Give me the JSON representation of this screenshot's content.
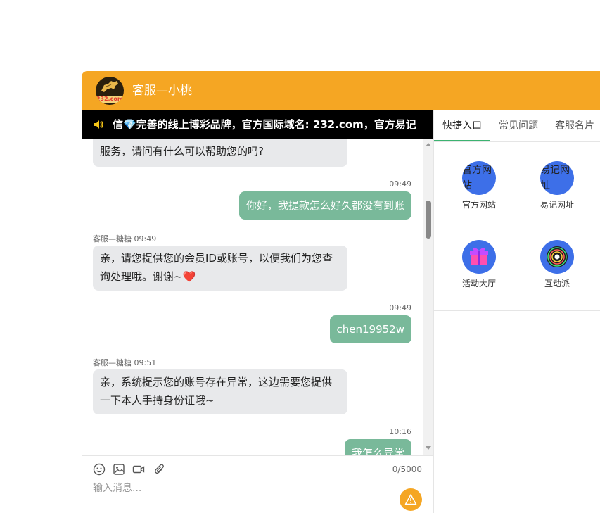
{
  "header": {
    "title": "客服—小桃",
    "logo_brand": "232.com"
  },
  "ticker": {
    "text": "信💎完善的线上博彩品牌，官方国际域名: 232.com，官方易记"
  },
  "messages": [
    {
      "role": "agent",
      "text": "服务，请问有什么可以帮助您的吗?"
    },
    {
      "role": "user",
      "time": "09:49",
      "text": "你好，我提款怎么好久都没有到账"
    },
    {
      "role": "agent",
      "sender": "客服—糖糖",
      "time": "09:49",
      "text": "亲，请您提供您的会员ID或账号，以便我们为您查询处理哦。谢谢~❤️"
    },
    {
      "role": "user",
      "time": "09:49",
      "text": "chen19952w"
    },
    {
      "role": "agent",
      "sender": "客服—糖糖",
      "time": "09:51",
      "text": "亲，系统提示您的账号存在异常，这边需要您提供一下本人手持身份证哦~"
    },
    {
      "role": "user",
      "time": "10:16",
      "text": "我怎么异常"
    }
  ],
  "input": {
    "placeholder": "输入消息...",
    "value": "",
    "counter": "0/5000"
  },
  "sidebar": {
    "tabs": [
      {
        "label": "快捷入口",
        "active": true
      },
      {
        "label": "常见问题",
        "active": false
      },
      {
        "label": "客服名片",
        "active": false
      }
    ],
    "quick_links": [
      {
        "label": "官方网站",
        "icon_alt": "官方网站",
        "icon": "broken-image-icon"
      },
      {
        "label": "易记网址",
        "icon_alt": "易记网址",
        "icon": "broken-image-icon"
      },
      {
        "label": "活动大厅",
        "icon": "gift-icon"
      },
      {
        "label": "互动派",
        "icon": "camera-lens-icon"
      }
    ]
  },
  "colors": {
    "header": "#f5a623",
    "user_bubble": "#79b99a",
    "agent_bubble": "#e8e9eb",
    "tab_active_underline": "#3cb371",
    "quick_icon": "#3d6fe8"
  }
}
